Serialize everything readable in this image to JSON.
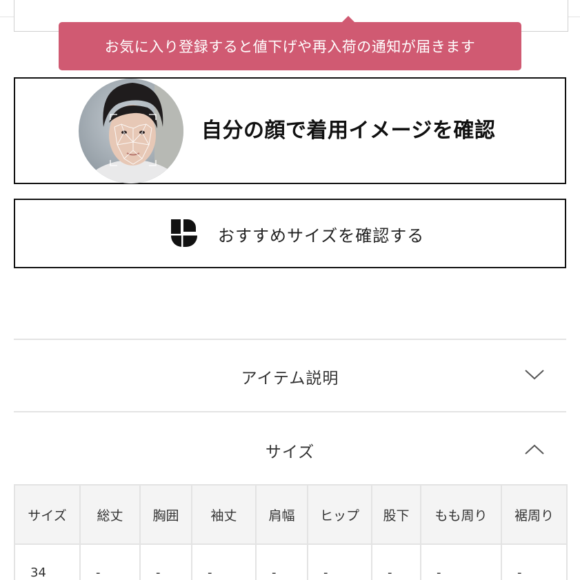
{
  "toast": {
    "message": "お気に入り登録すると値下げや再入荷の通知が届きます",
    "color": "#d05a72"
  },
  "face_check": {
    "label": "自分の顔で着用イメージを確認",
    "image": "face-scan-portrait"
  },
  "size_recommend": {
    "label": "おすすめサイズを確認する",
    "logo": "unisize-logo-icon"
  },
  "accordions": [
    {
      "label": "アイテム説明",
      "icon": "chevron-down-icon"
    },
    {
      "label": "サイズ",
      "icon": "chevron-up-icon"
    }
  ],
  "size_table": {
    "headers": [
      "サイズ",
      "総丈",
      "胸囲",
      "袖丈",
      "肩幅",
      "ヒップ",
      "股下",
      "もも周り",
      "裾周り"
    ],
    "rows": [
      [
        "34",
        "-",
        "-",
        "-",
        "-",
        "-",
        "-",
        "-",
        "-"
      ]
    ]
  }
}
